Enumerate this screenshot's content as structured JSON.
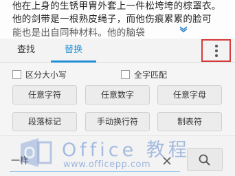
{
  "document": {
    "lines": [
      "他在上身的生锈甲胄外套上一件松垮垮的棕罩衣。",
      "他的剑带是一根熟皮绳子，而他伤痕累累的脸可",
      "能也是出自同种材料。他的脑袋"
    ]
  },
  "tabs": {
    "find_label": "查找",
    "replace_label": "替换",
    "active": "替换"
  },
  "options": {
    "match_case_label": "区分大小写",
    "match_case_checked": false,
    "whole_word_label": "全字匹配",
    "whole_word_checked": false
  },
  "special_buttons": [
    "任意字符",
    "任意数字",
    "任意字母",
    "段落标记",
    "手动换行符",
    "制表符"
  ],
  "replace_input": {
    "value": "一样"
  },
  "watermark": {
    "title": "Office 教程",
    "url": "www.officepp.com"
  },
  "icons": {
    "more": "more-vertical-icon",
    "clear": "close-icon",
    "search": "search-icon",
    "collapse": "chevron-down-icon"
  },
  "colors": {
    "accent": "#1f8fd6",
    "highlight_box": "#d63b3b"
  }
}
